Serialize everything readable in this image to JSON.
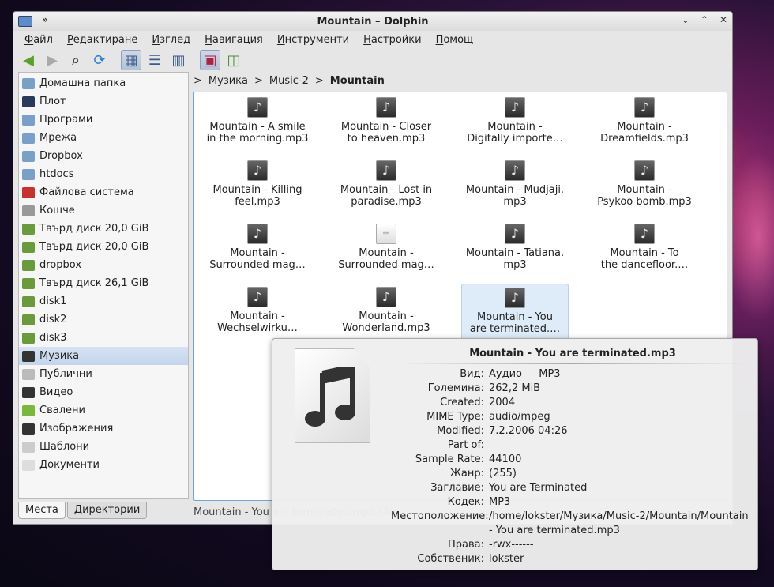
{
  "window": {
    "title": "Mountain – Dolphin",
    "keep_above": "»",
    "buttons": {
      "minimize": "⌄",
      "maximize": "⌃",
      "close": "✕"
    }
  },
  "menu": [
    "Файл",
    "Редактиране",
    "Изглед",
    "Навигация",
    "Инструменти",
    "Настройки",
    "Помощ"
  ],
  "toolbar": {
    "back": "◀",
    "forward": "▶",
    "search": "⌕",
    "reload": "⟳",
    "icons_view": "▦",
    "details_view": "☰",
    "columns_view": "▥",
    "preview": "▣",
    "split": "◫"
  },
  "places": [
    {
      "label": "Домашна папка",
      "icon": "home-icon",
      "color": "#7aa0c8"
    },
    {
      "label": "Плот",
      "icon": "desktop-icon",
      "color": "#2a3a5a"
    },
    {
      "label": "Програми",
      "icon": "applications-icon",
      "color": "#7aa0c8"
    },
    {
      "label": "Мрежа",
      "icon": "network-icon",
      "color": "#7aa0c8"
    },
    {
      "label": "Dropbox",
      "icon": "folder-icon",
      "color": "#7aa0c8"
    },
    {
      "label": "htdocs",
      "icon": "folder-icon",
      "color": "#7aa0c8"
    },
    {
      "label": "Файлова система",
      "icon": "filesystem-icon",
      "color": "#c83030"
    },
    {
      "label": "Кошче",
      "icon": "trash-icon",
      "color": "#999999"
    },
    {
      "label": "Твърд диск 20,0 GiB",
      "icon": "harddisk-icon",
      "color": "#6a9a3a"
    },
    {
      "label": "Твърд диск 20,0 GiB",
      "icon": "harddisk-icon",
      "color": "#6a9a3a"
    },
    {
      "label": "dropbox",
      "icon": "harddisk-icon",
      "color": "#6a9a3a"
    },
    {
      "label": "Твърд диск 26,1 GiB",
      "icon": "harddisk-icon",
      "color": "#6a9a3a"
    },
    {
      "label": "disk1",
      "icon": "harddisk-icon",
      "color": "#6a9a3a"
    },
    {
      "label": "disk2",
      "icon": "harddisk-icon",
      "color": "#6a9a3a"
    },
    {
      "label": "disk3",
      "icon": "harddisk-icon",
      "color": "#6a9a3a"
    },
    {
      "label": "Музика",
      "icon": "music-icon",
      "color": "#333333"
    },
    {
      "label": "Публични",
      "icon": "public-icon",
      "color": "#bbbbbb"
    },
    {
      "label": "Видео",
      "icon": "video-icon",
      "color": "#333333"
    },
    {
      "label": "Свалени",
      "icon": "download-icon",
      "color": "#7ab83a"
    },
    {
      "label": "Изображения",
      "icon": "pictures-icon",
      "color": "#333333"
    },
    {
      "label": "Шаблони",
      "icon": "templates-icon",
      "color": "#cccccc"
    },
    {
      "label": "Документи",
      "icon": "documents-icon",
      "color": "#dddddd"
    }
  ],
  "side_tabs": [
    "Места",
    "Директории"
  ],
  "breadcrumb": [
    "Музика",
    "Music-2",
    "Mountain"
  ],
  "breadcrumb_sep": ">",
  "files": [
    {
      "l1": "Mountain - A smile",
      "l2": "in the morning.mp3",
      "icon": "♪"
    },
    {
      "l1": "Mountain - Closer",
      "l2": "to heaven.mp3",
      "icon": "♪"
    },
    {
      "l1": "Mountain -",
      "l2": "Digitally importe…",
      "icon": "♪"
    },
    {
      "l1": "Mountain -",
      "l2": "Dreamfields.mp3",
      "icon": "♪"
    },
    {
      "l1": "Mountain - Killing",
      "l2": "feel.mp3",
      "icon": "♪"
    },
    {
      "l1": "Mountain - Lost in",
      "l2": "paradise.mp3",
      "icon": "♪"
    },
    {
      "l1": "Mountain - Mudjaji.",
      "l2": "mp3",
      "icon": "♪"
    },
    {
      "l1": "Mountain -",
      "l2": "Psykoo bomb.mp3",
      "icon": "♪"
    },
    {
      "l1": "Mountain -",
      "l2": "Surrounded mag…",
      "icon": "♪"
    },
    {
      "l1": "Mountain -",
      "l2": "Surrounded mag…",
      "icon": "≡"
    },
    {
      "l1": "Mountain - Tatiana.",
      "l2": "mp3",
      "icon": "♪"
    },
    {
      "l1": "Mountain - To",
      "l2": "the dancefloor.…",
      "icon": "♪"
    },
    {
      "l1": "Mountain -",
      "l2": "Wechselwirku…",
      "icon": "♪"
    },
    {
      "l1": "Mountain -",
      "l2": "Wonderland.mp3",
      "icon": "♪"
    },
    {
      "l1": "Mountain - You",
      "l2": "are terminated.…",
      "icon": "♪"
    }
  ],
  "status": "Mountain - You are terminated.mp3 (Au…",
  "tooltip": {
    "title": "Mountain - You are terminated.mp3",
    "rows": [
      {
        "k": "Вид:",
        "v": "Аудио — MP3"
      },
      {
        "k": "Големина:",
        "v": "262,2 MiB"
      },
      {
        "k": "Created:",
        "v": "2004"
      },
      {
        "k": "MIME Type:",
        "v": "audio/mpeg"
      },
      {
        "k": "Modified:",
        "v": "7.2.2006 04:26"
      },
      {
        "k": "Part of:",
        "v": ""
      },
      {
        "k": "Sample Rate:",
        "v": "44100"
      },
      {
        "k": "Жанр:",
        "v": "(255)"
      },
      {
        "k": "Заглавие:",
        "v": "You are Terminated"
      },
      {
        "k": "Кодек:",
        "v": "MP3"
      },
      {
        "k": "Местоположение:",
        "v": "/home/lokster/Музика/Music-2/Mountain/Mountain - You are terminated.mp3"
      },
      {
        "k": "Права:",
        "v": "-rwx------"
      },
      {
        "k": "Собственик:",
        "v": "lokster"
      }
    ]
  }
}
